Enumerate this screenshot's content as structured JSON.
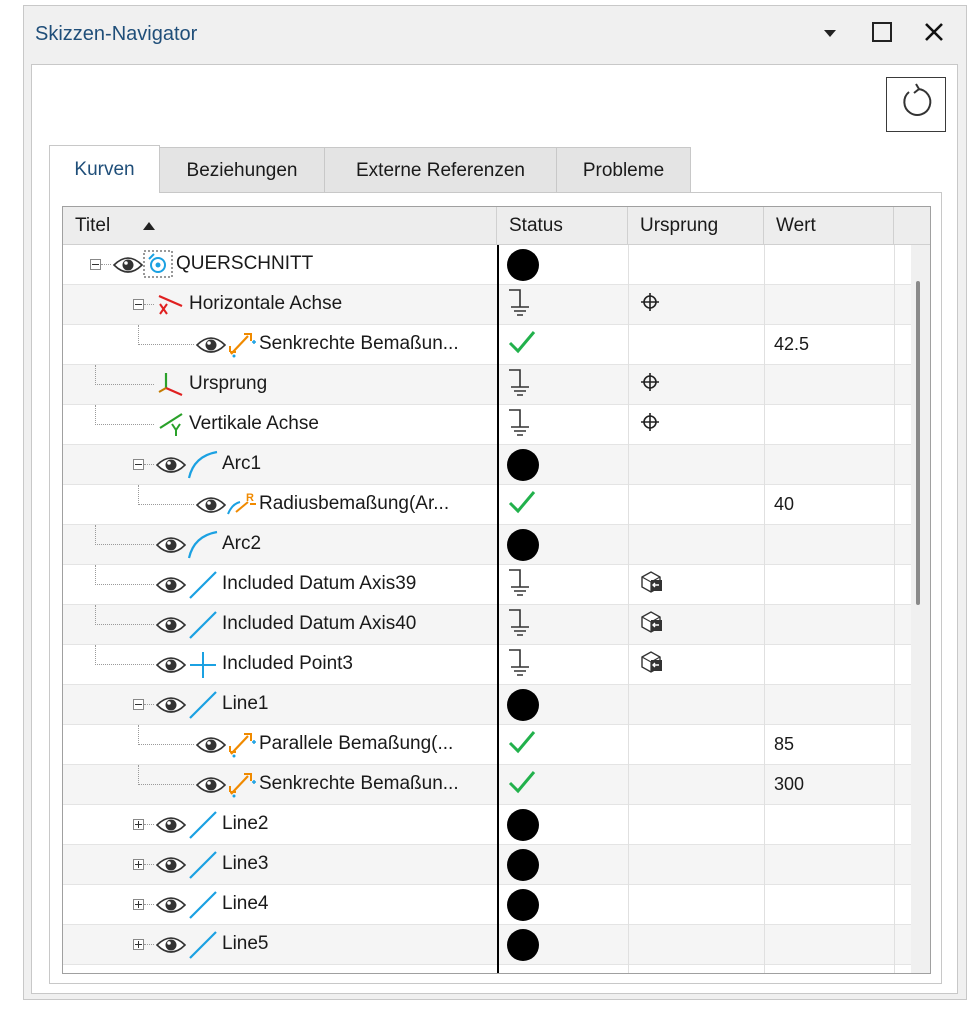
{
  "window": {
    "title": "Skizzen-Navigator",
    "menu_icon": "dropdown-arrow-icon",
    "maximize_icon": "maximize-icon",
    "close_icon": "close-icon"
  },
  "reset_icon": "undo-rotate-icon",
  "tabs": [
    {
      "label": "Kurven",
      "active": true
    },
    {
      "label": "Beziehungen",
      "active": false
    },
    {
      "label": "Externe Referenzen",
      "active": false
    },
    {
      "label": "Probleme",
      "active": false
    }
  ],
  "columns": {
    "title": "Titel",
    "status": "Status",
    "origin": "Ursprung",
    "value": "Wert",
    "sort_icon": "sort-ascending-icon"
  },
  "rows": [
    {
      "label": "QUERSCHNITT",
      "status": "dot",
      "origin": "",
      "value": ""
    },
    {
      "label": "Horizontale Achse",
      "status": "ground",
      "origin": "crosshair",
      "value": ""
    },
    {
      "label": "Senkrechte Bemaßun...",
      "status": "check",
      "origin": "",
      "value": "42.5"
    },
    {
      "label": "Ursprung",
      "status": "ground",
      "origin": "crosshair",
      "value": ""
    },
    {
      "label": "Vertikale Achse",
      "status": "ground",
      "origin": "crosshair",
      "value": ""
    },
    {
      "label": "Arc1",
      "status": "dot",
      "origin": "",
      "value": ""
    },
    {
      "label": "Radiusbemaßung(Ar...",
      "status": "check",
      "origin": "",
      "value": "40"
    },
    {
      "label": "Arc2",
      "status": "dot",
      "origin": "",
      "value": ""
    },
    {
      "label": "Included Datum Axis39",
      "status": "ground",
      "origin": "external-ref",
      "value": ""
    },
    {
      "label": "Included Datum Axis40",
      "status": "ground",
      "origin": "external-ref",
      "value": ""
    },
    {
      "label": "Included Point3",
      "status": "ground",
      "origin": "external-ref",
      "value": ""
    },
    {
      "label": "Line1",
      "status": "dot",
      "origin": "",
      "value": ""
    },
    {
      "label": "Parallele Bemaßung(...",
      "status": "check",
      "origin": "",
      "value": "85"
    },
    {
      "label": "Senkrechte Bemaßun...",
      "status": "check",
      "origin": "",
      "value": "300"
    },
    {
      "label": "Line2",
      "status": "dot",
      "origin": "",
      "value": ""
    },
    {
      "label": "Line3",
      "status": "dot",
      "origin": "",
      "value": ""
    },
    {
      "label": "Line4",
      "status": "dot",
      "origin": "",
      "value": ""
    },
    {
      "label": "Line5",
      "status": "dot",
      "origin": "",
      "value": ""
    }
  ],
  "colors": {
    "title_blue": "#1f4e79",
    "curve_blue": "#1ba1e2",
    "axis_red": "#e02020",
    "axis_green": "#2aa12a",
    "dim_orange": "#f08a00",
    "check_green": "#22b14c"
  }
}
